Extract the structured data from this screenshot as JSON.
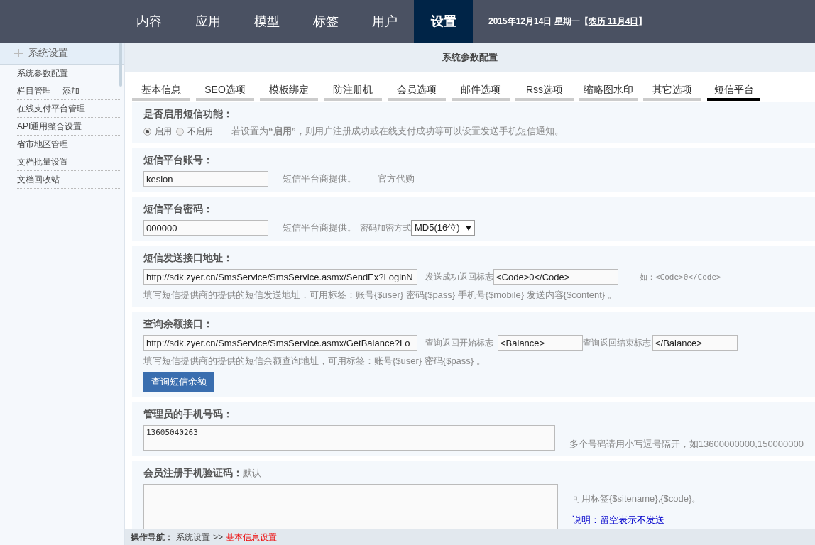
{
  "nav": {
    "items": [
      {
        "label": "内容",
        "selected": false
      },
      {
        "label": "应用",
        "selected": false
      },
      {
        "label": "模型",
        "selected": false
      },
      {
        "label": "标签",
        "selected": false
      },
      {
        "label": "用户",
        "selected": false
      },
      {
        "label": "设置",
        "selected": true
      }
    ],
    "date": "2015年12月14日 星期一【",
    "lunar": "农历 11月4日",
    "date_end": "】"
  },
  "sidebar": {
    "title": "系统设置",
    "items": [
      {
        "label": "系统参数配置"
      },
      {
        "label": "栏目管理",
        "extra": "添加"
      },
      {
        "label": "在线支付平台管理"
      },
      {
        "label": "API通用整合设置"
      },
      {
        "label": "省市地区管理"
      },
      {
        "label": "文档批量设置"
      },
      {
        "label": "文档回收站"
      }
    ]
  },
  "page_title": "系统参数配置",
  "tabs": [
    {
      "label": "基本信息",
      "selected": false
    },
    {
      "label": "SEO选项",
      "selected": false
    },
    {
      "label": "模板绑定",
      "selected": false
    },
    {
      "label": "防注册机",
      "selected": false
    },
    {
      "label": "会员选项",
      "selected": false
    },
    {
      "label": "邮件选项",
      "selected": false
    },
    {
      "label": "Rss选项",
      "selected": false
    },
    {
      "label": "缩略图水印",
      "selected": false
    },
    {
      "label": "其它选项",
      "selected": false
    },
    {
      "label": "短信平台",
      "selected": true
    }
  ],
  "enable": {
    "label": "是否启用短信功能：",
    "options": [
      {
        "label": "启用",
        "selected": true
      },
      {
        "label": "不启用",
        "selected": false
      }
    ],
    "note": "若设置为**“启用”**，则用户注册成功或在线支付成功等可以设置发送手机短信通知。"
  },
  "account": {
    "label": "短信平台账号：",
    "value": "kesion",
    "hint": "短信平台商提供。",
    "link": "官方代购"
  },
  "password": {
    "label": "短信平台密码：",
    "value": "000000",
    "hint": "短信平台商提供。",
    "select_label": "密码加密方式",
    "select_value": "MD5(16位)"
  },
  "send_url": {
    "label": "短信发送接口地址：",
    "value": "http://sdk.zyer.cn/SmsService/SmsService.asmx/SendEx?LoginN",
    "flag_label": "发送成功返回标志",
    "flag_value": "<Code>0</Code>",
    "example": "如：<Code>0</Code>",
    "help": "填写短信提供商的提供的短信发送地址，可用标签：账号{$user} 密码{$pass} 手机号{$mobile} 发送内容{$content} 。"
  },
  "balance": {
    "label": "查询余额接口：",
    "value": "http://sdk.zyer.cn/SmsService/SmsService.asmx/GetBalance?Lo",
    "start_label": "查询返回开始标志",
    "start_value": "<Balance>",
    "end_label": "查询返回结束标志",
    "end_value": "</Balance>",
    "help": "填写短信提供商的提供的短信余额查询地址，可用标签：账号{$user} 密码{$pass} 。",
    "button": "查询短信余额"
  },
  "admin_phone": {
    "label": "管理员的手机号码：",
    "value": "13605040263",
    "hint": "多个号码请用小写逗号隔开，如13600000000,150000000"
  },
  "register_code": {
    "label": "会员注册手机验证码：",
    "default": "默认",
    "hint": "可用标签{$sitename},{$code}。",
    "note": "说明：留空表示不发送"
  },
  "footer": {
    "label": "操作导航：",
    "path": "系统设置",
    "sep": ">>",
    "current": "基本信息设置"
  }
}
